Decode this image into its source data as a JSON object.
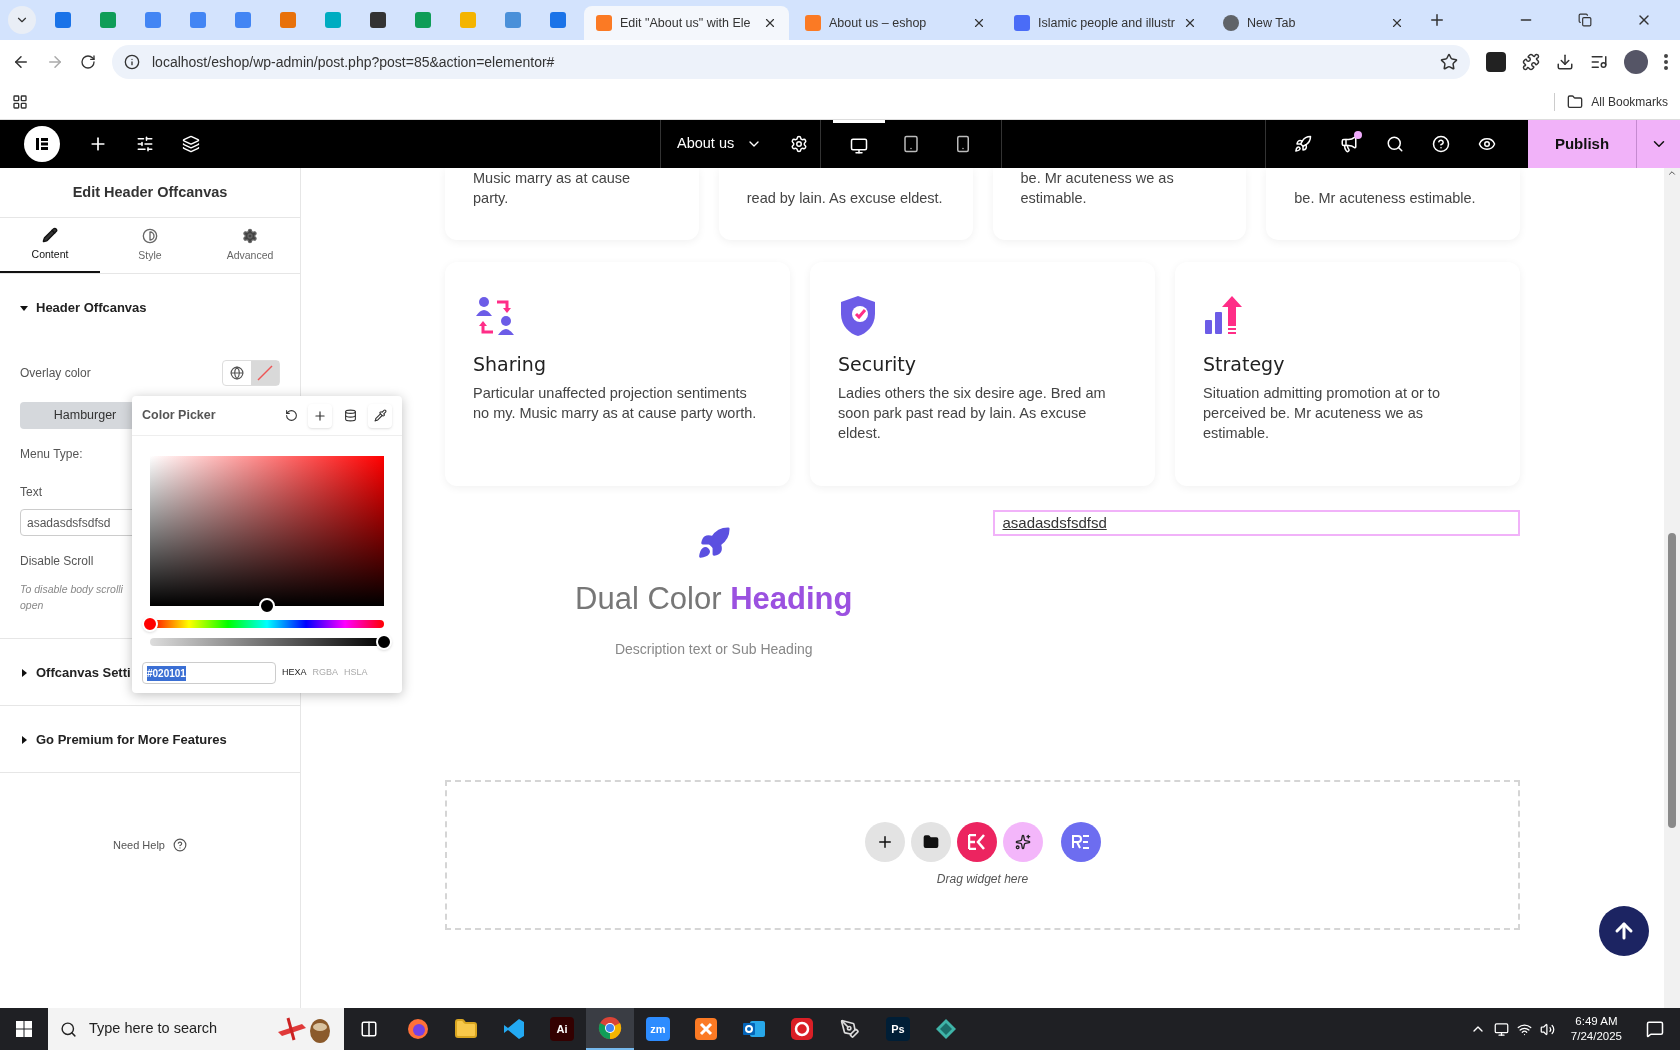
{
  "browser": {
    "tabs": [
      {
        "label": "Edit \"About us\" with Ele",
        "selected": true
      },
      {
        "label": "About us – eshop",
        "selected": false
      },
      {
        "label": "Islamic people and illustr",
        "selected": false
      },
      {
        "label": "New Tab",
        "selected": false
      }
    ],
    "url": "localhost/eshop/wp-admin/post.php?post=85&action=elementor#",
    "bookmarks_label": "All Bookmarks"
  },
  "topbar": {
    "page": "About us",
    "devices": [
      {
        "kind": "desktop",
        "selected": true
      },
      {
        "kind": "tablet",
        "selected": false
      },
      {
        "kind": "mobile",
        "selected": false
      }
    ],
    "publish": "Publish"
  },
  "panel": {
    "title": "Edit Header Offcanvas",
    "tabs": [
      {
        "label": "Content",
        "kind": "pencil",
        "selected": true
      },
      {
        "label": "Style",
        "kind": "contrast",
        "selected": false
      },
      {
        "label": "Advanced",
        "kind": "gear",
        "selected": false
      }
    ],
    "sections": [
      {
        "title": "Header Offcanvas",
        "expanded": true
      },
      {
        "title": "Offcanvas Setti",
        "expanded": false
      },
      {
        "title": "Go Premium for More Features",
        "expanded": false
      }
    ],
    "overlay_label": "Overlay color",
    "menu_button": "Hamburger",
    "menu_type_label": "Menu Type:",
    "text_label": "Text",
    "text_value": "asadasdsfsdfsd",
    "disable_scroll_label": "Disable Scroll",
    "hint": "To disable body scrolli",
    "hint_line2": "open",
    "help": "Need Help"
  },
  "color_picker": {
    "title": "Color Picker",
    "saturation": {
      "level": 0.5
    },
    "hue": {
      "level": 0
    },
    "alpha": {
      "level": 1
    },
    "hex": "#020101",
    "formats": [
      {
        "label": "HEXA",
        "selected": true
      },
      {
        "label": "RGBA",
        "selected": false
      },
      {
        "label": "HSLA",
        "selected": false
      }
    ]
  },
  "top_cards": [
    {
      "lines": [
        "Music marry as at cause",
        "party."
      ]
    },
    {
      "lines": [
        "read by lain. As excuse eldest."
      ]
    },
    {
      "lines": [
        "be. Mr acuteness we as",
        "estimable."
      ]
    },
    {
      "lines": [
        "be. Mr acuteness estimable."
      ]
    }
  ],
  "features": [
    {
      "kind": "sharing",
      "title": "Sharing",
      "text": "Particular unaffected projection sentiments no my. Music marry as at cause party worth."
    },
    {
      "kind": "security",
      "title": "Security",
      "text": "Ladies others the six desire age. Bred am soon park past read by lain. As excuse eldest."
    },
    {
      "kind": "strategy",
      "title": "Strategy",
      "text": "Situation admitting promotion at or to perceived be. Mr acuteness we as estimable."
    }
  ],
  "dual_heading": {
    "first": "Dual Color",
    "second": "Heading",
    "description": "Description text or Sub Heading"
  },
  "offcanvas_link": "asadasdsfsdfsd",
  "drop_zone": {
    "hint": "Drag widget here"
  },
  "taskbar": {
    "search_placeholder": "Type here to search",
    "apps": [
      {
        "kind": "firefox",
        "selected": false
      },
      {
        "kind": "folder",
        "selected": false
      },
      {
        "kind": "vscode",
        "selected": false
      },
      {
        "kind": "badge",
        "label": "Ai",
        "color": "#330000",
        "selected": false
      },
      {
        "kind": "chrome",
        "selected": true
      },
      {
        "kind": "badge",
        "label": "zm",
        "color": "#2d8cff",
        "selected": false
      },
      {
        "kind": "xampp",
        "selected": false
      },
      {
        "kind": "outlook",
        "selected": false
      },
      {
        "kind": "cloud",
        "selected": false
      },
      {
        "kind": "pen",
        "selected": false
      },
      {
        "kind": "badge",
        "label": "Ps",
        "color": "#001e36",
        "selected": false
      },
      {
        "kind": "gem",
        "selected": false
      }
    ],
    "time": "6:49 AM",
    "date": "7/24/2025"
  }
}
